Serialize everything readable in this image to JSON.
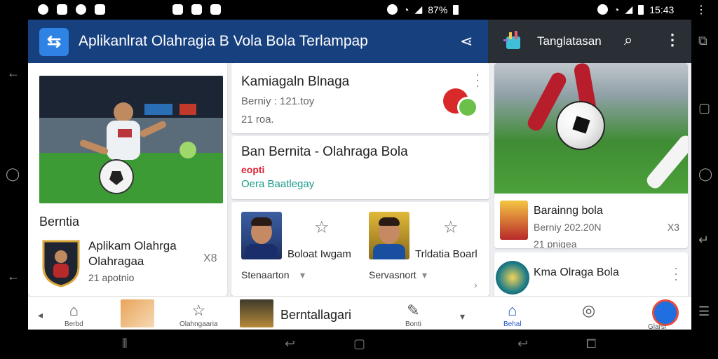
{
  "status_bar": {
    "battery": "87%",
    "time": "15:43"
  },
  "app": {
    "title": "Aplikanlrat Olahragia B Vola Bola Terlampap",
    "logo_icon": "sports-arrow-icon",
    "share_icon": "share-icon"
  },
  "tab_bar": {
    "label": "Tanglatasan",
    "search_icon": "search-icon",
    "more_icon": "more-vert-icon"
  },
  "hero": {
    "section_label": "Berntia",
    "title": "Aplikam Olahrga Olahragaa",
    "count": "X8",
    "meta": "21 apotnio"
  },
  "cards": [
    {
      "title": "Kamiagaln Blnaga",
      "meta": "Berniy : 121.toy",
      "meta2": "21 roa."
    },
    {
      "title": "Ban Bernita - Olahraga Bola",
      "red": "eopti",
      "teal": "Oera Baatlegay"
    }
  ],
  "people": [
    {
      "name": "Boloat Iwgam",
      "sub": "Stenaarton"
    },
    {
      "name": "Trldatia Boarl",
      "sub": "Servasnort"
    }
  ],
  "right_card": {
    "title": "Barainng bola",
    "meta": "Berniy 202.20N",
    "meta2": "21 pnigea",
    "count": "X3"
  },
  "right_card2": {
    "title": "Kma Olraga Bola"
  },
  "bottom_nav": {
    "items": [
      {
        "label": "Berbd",
        "icon": "home-outline-icon"
      },
      {
        "label": "Olahngaaria",
        "icon": "star-outline-icon"
      },
      {
        "label": "Bonti",
        "icon": "edit-icon"
      },
      {
        "label": "Behal",
        "icon": "home-filled-icon"
      },
      {
        "label": "Glarsi",
        "icon": "compass-icon"
      }
    ],
    "featured_label": "Berntallagari"
  }
}
